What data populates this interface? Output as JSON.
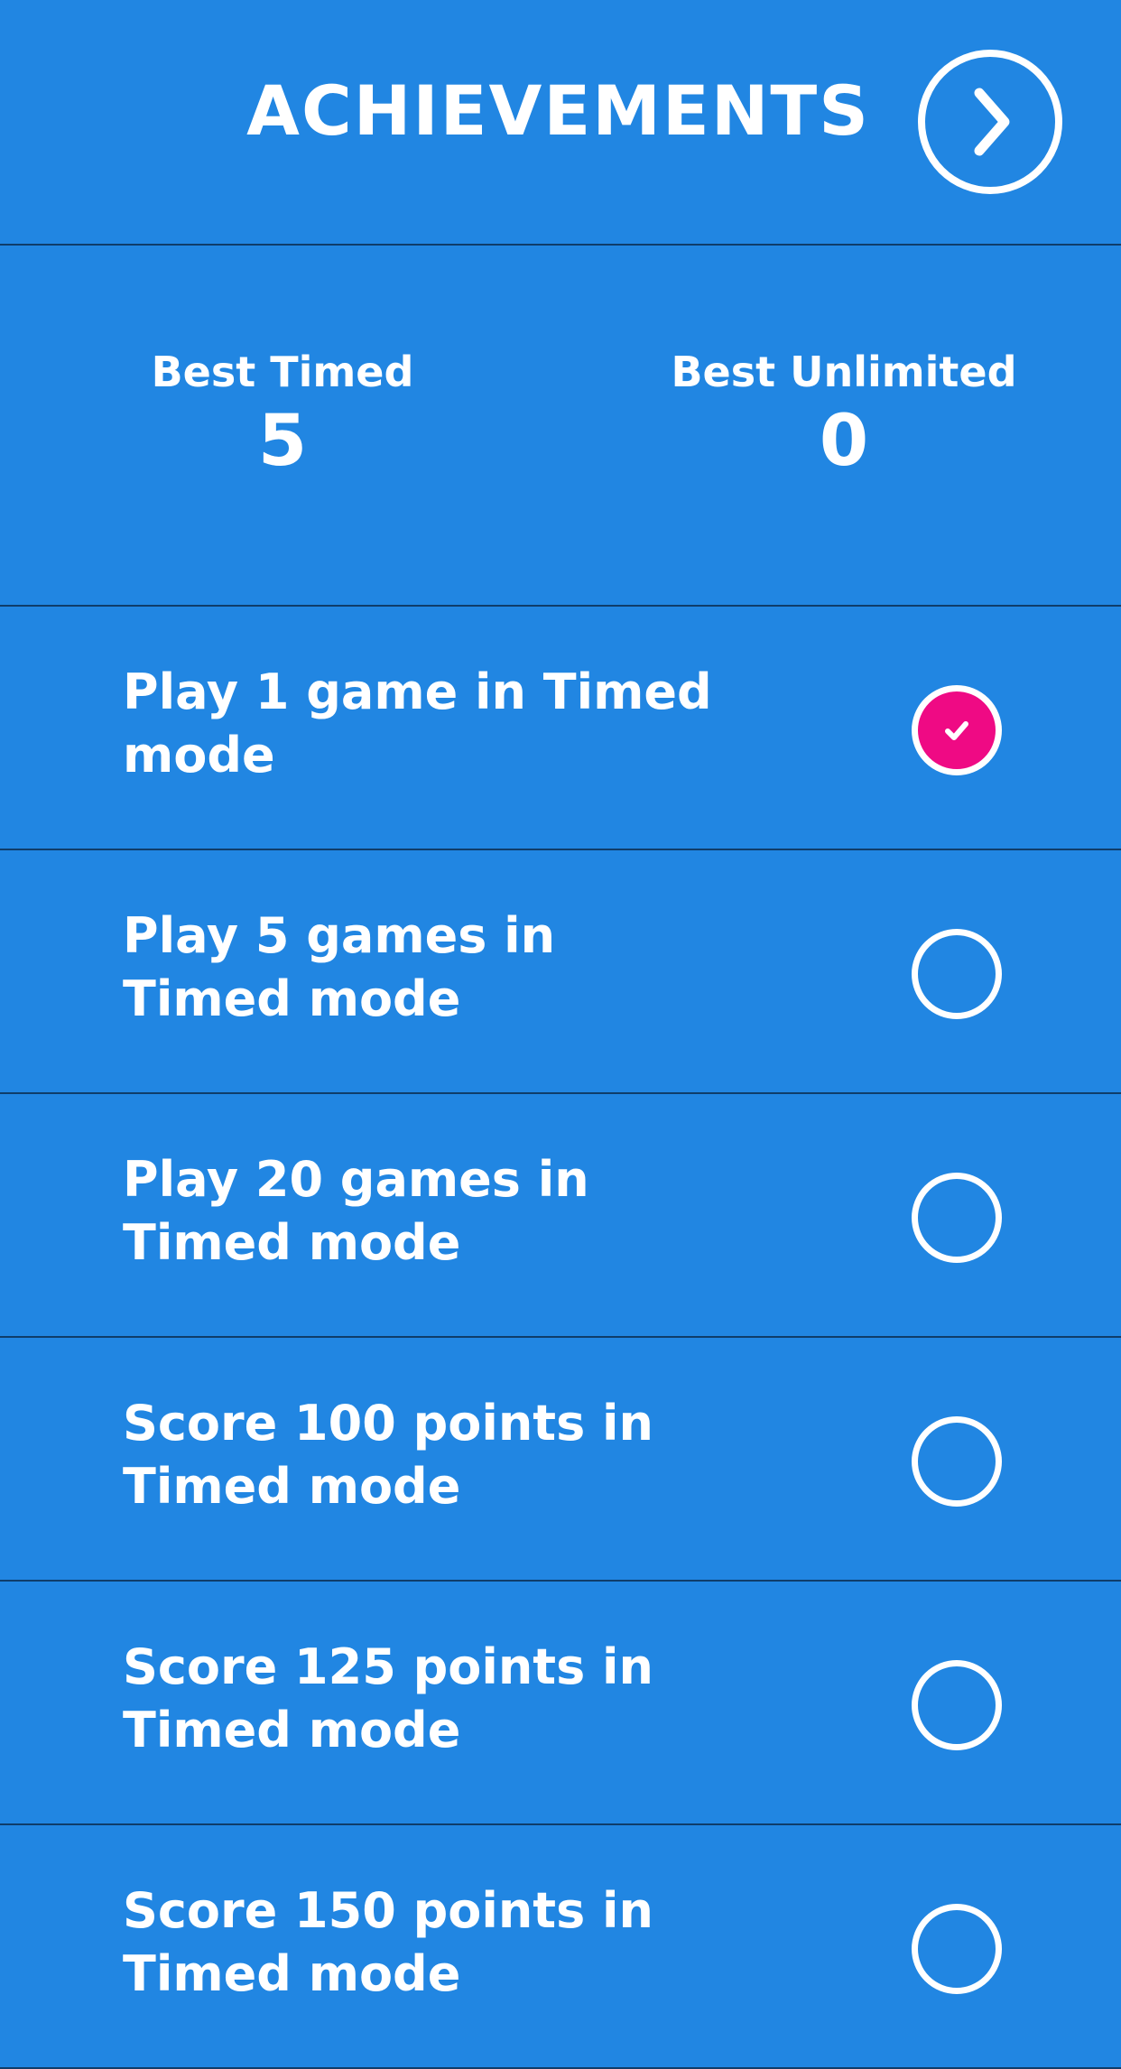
{
  "header": {
    "title": "ACHIEVEMENTS",
    "next_icon": "chevron-right-icon"
  },
  "stats": {
    "best_timed": {
      "label": "Best Timed",
      "value": "5"
    },
    "best_unlimited": {
      "label": "Best Unlimited",
      "value": "0"
    }
  },
  "achievements": [
    {
      "label": "Play 1 game in Timed mode",
      "completed": true
    },
    {
      "label": "Play 5 games in Timed mode",
      "completed": false
    },
    {
      "label": "Play 20 games in Timed mode",
      "completed": false
    },
    {
      "label": "Score 100 points in Timed mode",
      "completed": false
    },
    {
      "label": "Score 125 points in Timed mode",
      "completed": false
    },
    {
      "label": "Score 150 points in Timed mode",
      "completed": false
    }
  ],
  "colors": {
    "background": "#2186e2",
    "divider": "#0f3d6a",
    "completed": "#ef0a84",
    "foreground": "#ffffff"
  }
}
